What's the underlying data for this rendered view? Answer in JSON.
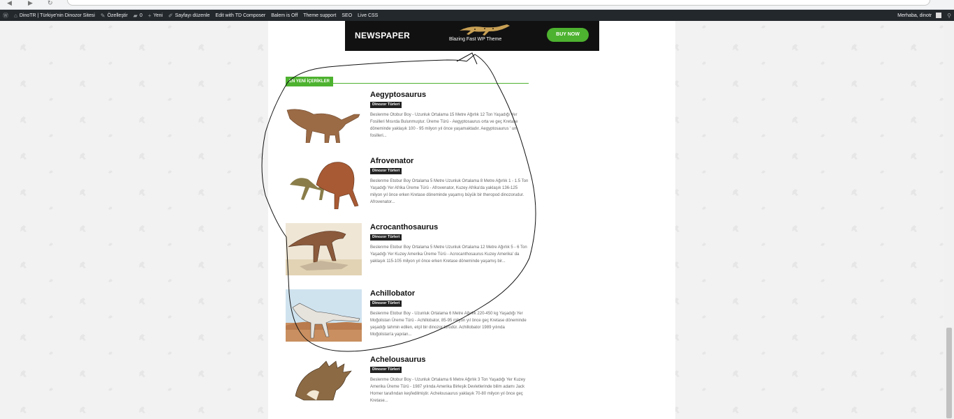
{
  "adminbar": {
    "items": [
      {
        "label": "DinoTR | Türkiye'nin Dinozor Sitesi",
        "icon": "home-icon"
      },
      {
        "label": "Özelleştir",
        "icon": "brush-icon"
      },
      {
        "label": "0",
        "icon": "comment-icon"
      },
      {
        "label": "Yeni",
        "icon": "plus-icon"
      },
      {
        "label": "Sayfayı düzenle",
        "icon": "pencil-icon"
      },
      {
        "label": "Edit with TD Composer"
      },
      {
        "label": "Balem is Off"
      },
      {
        "label": "Theme support"
      },
      {
        "label": "SEO"
      },
      {
        "label": "Live CSS"
      }
    ],
    "greeting": "Merhaba, dinotr",
    "search_icon": "search-icon"
  },
  "ad": {
    "brand": "NEWSPAPER",
    "tagline": "Blazing Fast WP Theme",
    "cta": "BUY NOW",
    "cta_color": "#4db22f"
  },
  "block": {
    "title": "EN YENİ İÇERİKLER",
    "accent": "#4db22f"
  },
  "posts": [
    {
      "title": "Aegyptosaurus",
      "category": "Dinozor Türleri",
      "excerpt": "Beslenme Otobur Boy - Uzunluk Ortalama 15 Metre Ağırlık 12 Ton Yaşadığı Yer Fosilleri Mısırda Bulunmuştur. Üreme Türü - Aegyptosaurus orta ve geç Kretase döneminde yaklaşık 100 - 95 milyon yıl önce yaşamaktadır. Aegyptosaurus ' un fosilleri..."
    },
    {
      "title": "Afrovenator",
      "category": "Dinozor Türleri",
      "excerpt": "Beslenme Etobur Boy Ortalama 5 Metre Uzunluk Ortalama 8 Metre Ağırlık 1 - 1.5 Ton Yaşadığı Yer Afrika Üreme Türü - Afrovenator, Kuzey Afrika'da yaklaşık 136-125 milyon yıl önce erken Kretase döneminde yaşamış büyük bir theropod dinozorudur. Afrovenator..."
    },
    {
      "title": "Acrocanthosaurus",
      "category": "Dinozor Türleri",
      "excerpt": "Beslenme Etobur Boy Ortalama 5 Metre Uzunluk Ortalama 12 Metre Ağırlık 5 - 6 Ton Yaşadığı Yer Kuzey Amerika Üreme Türü - Acrocanthosaurus Kuzey Amerika' da yaklaşık 115-105 milyon yıl önce erken Kretase döneminde yaşamış bir..."
    },
    {
      "title": "Achillobator",
      "category": "Dinozor Türleri",
      "excerpt": "Beslenme Etobur Boy - Uzunluk Ortalama 6 Metre Ağırlık 220-450 kg Yaşadığı Yer Moğolistan Üreme Türü - Achillobator, 85-95 milyon yıl önce geç Kretase döneminde yaşadığı tahmin edilen, etçil bir dinozor türüdür. Achillobator 1989 yılında Moğolistan'a yapılan..."
    },
    {
      "title": "Achelousaurus",
      "category": "Dinozor Türleri",
      "excerpt": "Beslenme Otobur Boy - Uzunluk Ortalama 6 Metre Ağırlık 3 Ton Yaşadığı Yer Kuzey Amerika Üreme Türü - 1987 yılında Amerika Birleşik Devletlerinde bilim adamı Jack Horner tarafından keşfedilmiştir. Achelousaurus yaklaşık 70-80 milyon yıl önce geç Kretase..."
    }
  ]
}
